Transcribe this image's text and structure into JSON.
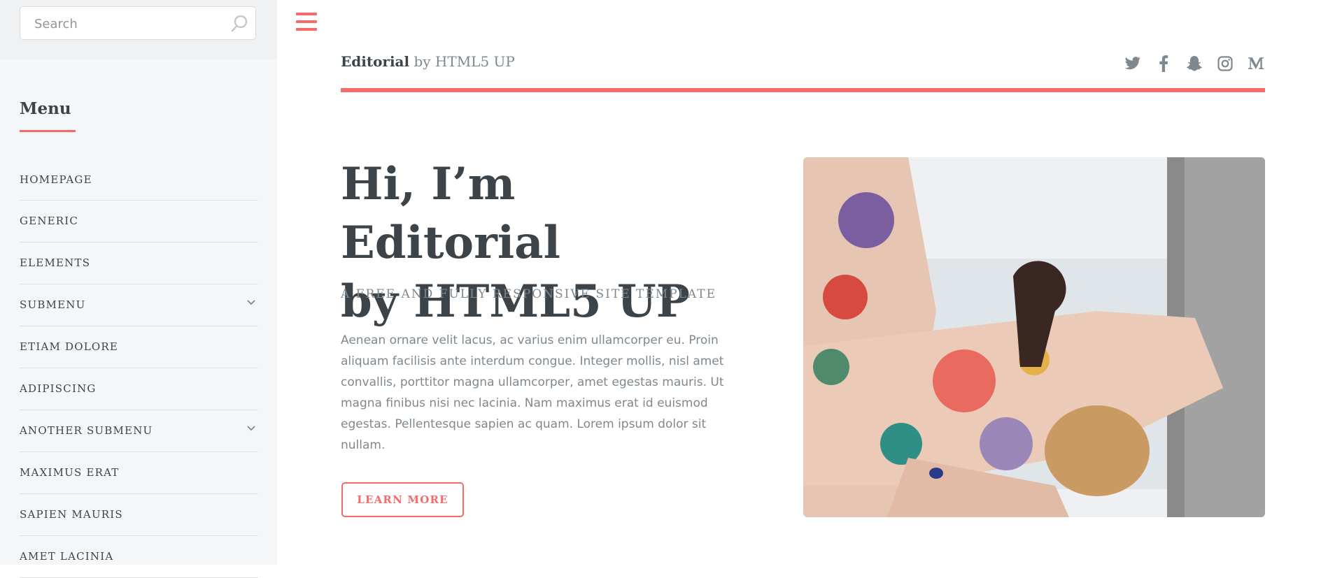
{
  "sidebar": {
    "search": {
      "placeholder": "Search"
    },
    "menu_heading": "Menu",
    "items": [
      {
        "label": "HOMEPAGE",
        "submenu": false
      },
      {
        "label": "GENERIC",
        "submenu": false
      },
      {
        "label": "ELEMENTS",
        "submenu": false
      },
      {
        "label": "SUBMENU",
        "submenu": true
      },
      {
        "label": "ETIAM DOLORE",
        "submenu": false
      },
      {
        "label": "ADIPISCING",
        "submenu": false
      },
      {
        "label": "ANOTHER SUBMENU",
        "submenu": true
      },
      {
        "label": "MAXIMUS ERAT",
        "submenu": false
      },
      {
        "label": "SAPIEN MAURIS",
        "submenu": false
      },
      {
        "label": "AMET LACINIA",
        "submenu": false
      }
    ]
  },
  "header": {
    "brand_strong": "Editorial",
    "brand_rest": " by HTML5 UP",
    "social_icons": [
      "twitter-icon",
      "facebook-icon",
      "snapchat-icon",
      "instagram-icon",
      "medium-icon"
    ]
  },
  "hero": {
    "title_line1": "Hi, I’m Editorial",
    "title_line2": "by HTML5 UP",
    "subtitle": "A FREE AND FULLY RESPONSIVE SITE TEMPLATE",
    "text": "Aenean ornare velit lacus, ac varius enim ullamcorper eu. Proin aliquam facilisis ante interdum congue. Integer mollis, nisl amet convallis, porttitor magna ullamcorper, amet egestas mauris. Ut magna finibus nisi nec lacinia. Nam maximus erat id euismod egestas. Pellentesque sapien ac quam. Lorem ipsum dolor sit nullam.",
    "button_label": "LEARN MORE"
  },
  "colors": {
    "accent": "#f56a6a",
    "text": "#3d4449",
    "muted": "#7f888f",
    "sidebar_bg": "#f5f6f7"
  }
}
